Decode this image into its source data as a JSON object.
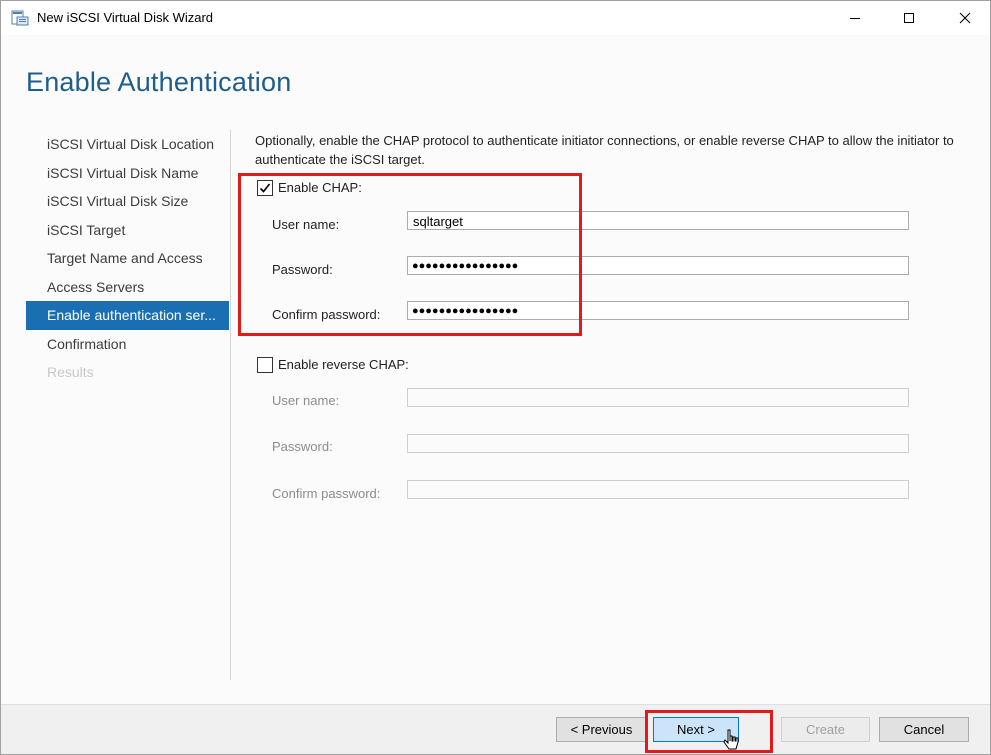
{
  "window": {
    "title": "New iSCSI Virtual Disk Wizard"
  },
  "page": {
    "heading": "Enable Authentication",
    "description": "Optionally, enable the CHAP protocol to authenticate initiator connections, or enable reverse CHAP to allow the initiator to authenticate the iSCSI target."
  },
  "nav": {
    "items": [
      {
        "label": "iSCSI Virtual Disk Location",
        "state": "normal"
      },
      {
        "label": "iSCSI Virtual Disk Name",
        "state": "normal"
      },
      {
        "label": "iSCSI Virtual Disk Size",
        "state": "normal"
      },
      {
        "label": "iSCSI Target",
        "state": "normal"
      },
      {
        "label": "Target Name and Access",
        "state": "normal"
      },
      {
        "label": "Access Servers",
        "state": "normal"
      },
      {
        "label": "Enable authentication ser...",
        "state": "active"
      },
      {
        "label": "Confirmation",
        "state": "normal"
      },
      {
        "label": "Results",
        "state": "disabled"
      }
    ]
  },
  "chap": {
    "checkbox_label": "Enable CHAP:",
    "checked": true,
    "username_label": "User name:",
    "username_value": "sqltarget",
    "password_label": "Password:",
    "password_value": "●●●●●●●●●●●●●●●●",
    "confirm_label": "Confirm password:",
    "confirm_value": "●●●●●●●●●●●●●●●●"
  },
  "reverse_chap": {
    "checkbox_label": "Enable reverse CHAP:",
    "checked": false,
    "username_label": "User name:",
    "username_value": "",
    "password_label": "Password:",
    "password_value": "",
    "confirm_label": "Confirm password:",
    "confirm_value": ""
  },
  "footer": {
    "previous_label": "< Previous",
    "next_label": "Next >",
    "create_label": "Create",
    "cancel_label": "Cancel"
  },
  "colors": {
    "heading": "#1e5d8c",
    "nav_active": "#1a6fb3",
    "highlight": "#e01b1b"
  },
  "icons": {
    "app": "wizard-window-icon",
    "minimize": "minimize-icon",
    "maximize": "maximize-icon",
    "close": "close-icon",
    "checkmark": "checkmark-icon",
    "cursor": "mouse-pointer-icon"
  }
}
